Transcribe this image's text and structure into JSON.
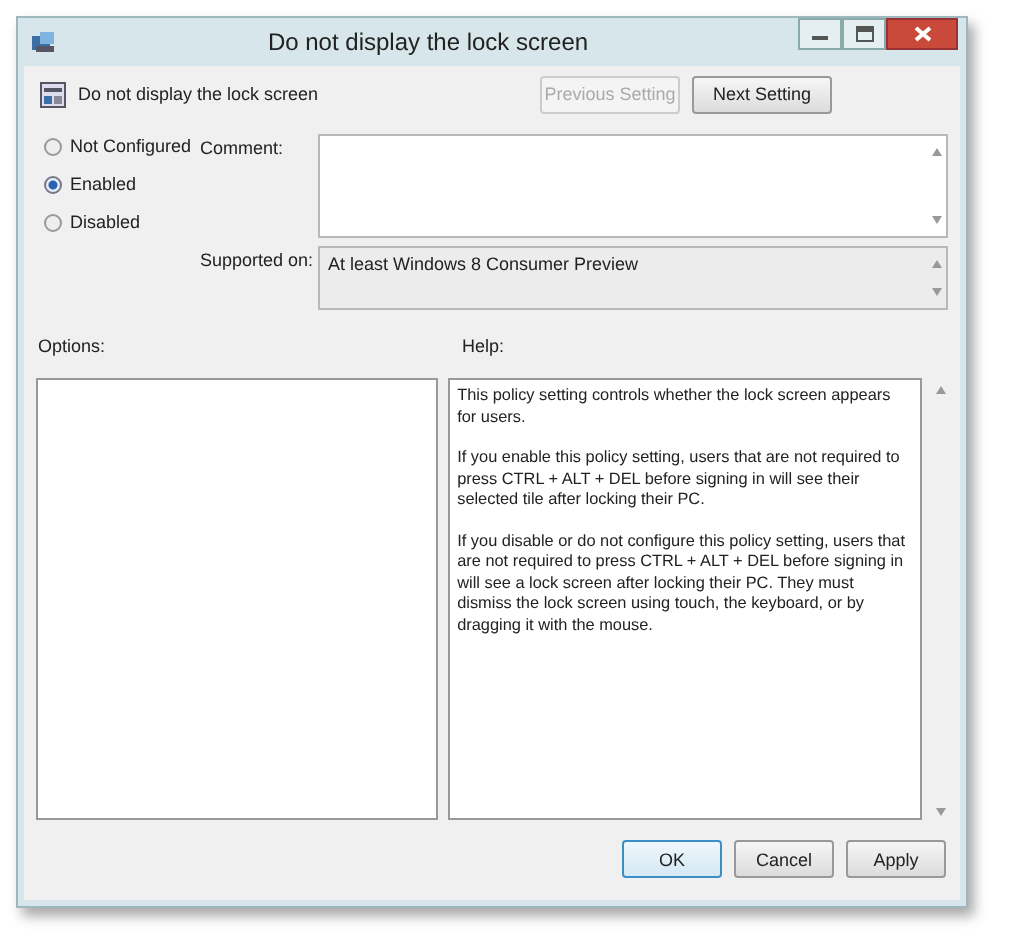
{
  "window": {
    "title": "Do not display the lock screen"
  },
  "setting_name": "Do not display the lock screen",
  "nav_buttons": [
    {
      "label": "Previous Setting",
      "disabled": true
    },
    {
      "label": "Next Setting",
      "disabled": false
    }
  ],
  "states": [
    {
      "label": "Not Configured",
      "selected": false
    },
    {
      "label": "Enabled",
      "selected": true
    },
    {
      "label": "Disabled",
      "selected": false
    }
  ],
  "comment": {
    "label": "Comment:"
  },
  "supported_on": {
    "label": "Supported on:",
    "value": "At least Windows 8 Consumer Preview"
  },
  "options": {
    "label": "Options:"
  },
  "help": {
    "label": "Help:",
    "paragraphs": [
      "This policy setting controls whether the lock screen appears for users.",
      "If you enable this policy setting, users that are not required to press CTRL + ALT + DEL before signing in will see their selected tile after  locking their PC.",
      "If you disable or do not configure this policy setting, users that are not required to press CTRL + ALT + DEL before signing in will see a lock screen after locking their PC. They must dismiss the lock screen using touch, the keyboard, or by dragging it with the mouse."
    ]
  },
  "buttons": [
    {
      "label": "OK",
      "default": true
    },
    {
      "label": "Cancel",
      "default": false
    },
    {
      "label": "Apply",
      "default": false
    }
  ]
}
